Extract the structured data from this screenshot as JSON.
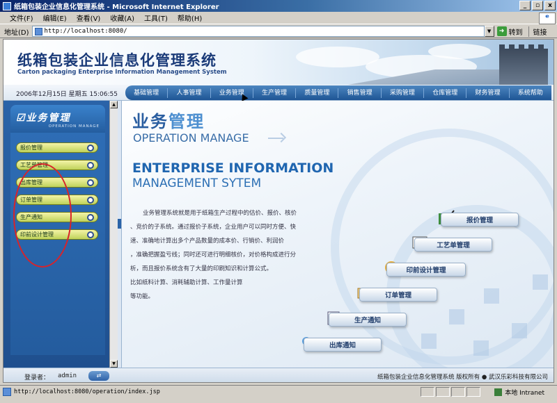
{
  "window": {
    "title": "纸箱包装企业信息化管理系统 - Microsoft Internet Explorer",
    "controls": [
      "_",
      "▫",
      "x"
    ]
  },
  "menu": [
    "文件(F)",
    "编辑(E)",
    "查看(V)",
    "收藏(A)",
    "工具(T)",
    "帮助(H)"
  ],
  "address": {
    "label": "地址(D)",
    "url": "http://localhost:8080/",
    "go_label": "转到",
    "links_label": "链接"
  },
  "header": {
    "title": "纸箱包装企业信息化管理系统",
    "subtitle": "Carton packaging Enterprise Information Management System"
  },
  "datetime": "2006年12月15日 星期五  15:06:55",
  "nav": [
    "基础管理",
    "人事管理",
    "业务管理",
    "生产管理",
    "质量管理",
    "销售管理",
    "采购管理",
    "仓库管理",
    "财务管理",
    "系统帮助"
  ],
  "sidebar": {
    "title": "☑业务管理",
    "subtitle": "OPERATION MANAGE",
    "items": [
      "报价管理",
      "工艺单管理",
      "出库管理",
      "订单管理",
      "生产通知",
      "印前设计管理"
    ]
  },
  "main": {
    "title_a": "业务",
    "title_b": "管理",
    "title_en": "OPERATION MANAGE",
    "ent_line1": "ENTERPRISE INFORMATION",
    "ent_line2": "MANAGEMENT SYTEM",
    "description": [
      "业务管理系统就是用于纸箱生产过程中的估价、报价、核价",
      "、竞价的子系统。通过报价子系统，企业用户可以同时方便、快",
      "速、准确地计算出多个产品数量的成本价、行销价、利润价",
      "，准确把握盈亏线；同时还可进行明细核价，对价格构成进行分",
      "析，而且报价系统含有了大量的印刷知识和计算公式。",
      "比如纸料计算、消耗辅助计算、工作量计算",
      "等功能。"
    ],
    "stairs": [
      "报价管理",
      "工艺单管理",
      "印前设计管理",
      "订单管理",
      "生产通知",
      "出库通知"
    ]
  },
  "footer": {
    "login_label": "登录者：",
    "user": "admin",
    "copyright": "纸箱包装企业信息化管理系统 版权所有 ● 武汉乐彩科技有限公司"
  },
  "status": {
    "url": "http://localhost:8080/operation/index.jsp",
    "zone": "本地 Intranet"
  },
  "colors": {
    "accent": "#1e5595",
    "sidebar": "#2a63a8",
    "highlight_circle": "#d8232a"
  }
}
